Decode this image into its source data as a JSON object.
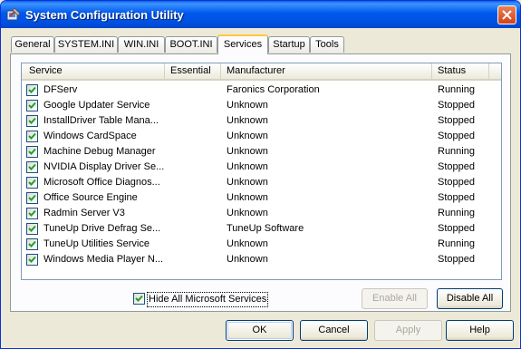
{
  "window": {
    "title": "System Configuration Utility"
  },
  "tabs": [
    {
      "label": "General"
    },
    {
      "label": "SYSTEM.INI"
    },
    {
      "label": "WIN.INI"
    },
    {
      "label": "BOOT.INI"
    },
    {
      "label": "Services",
      "active": true
    },
    {
      "label": "Startup"
    },
    {
      "label": "Tools"
    }
  ],
  "services": {
    "columns": {
      "service": "Service",
      "essential": "Essential",
      "manufacturer": "Manufacturer",
      "status": "Status"
    },
    "rows": [
      {
        "checked": true,
        "service": "DFServ",
        "essential": "",
        "manufacturer": "Faronics Corporation",
        "status": "Running"
      },
      {
        "checked": true,
        "service": "Google Updater Service",
        "essential": "",
        "manufacturer": "Unknown",
        "status": "Stopped"
      },
      {
        "checked": true,
        "service": "InstallDriver Table Mana...",
        "essential": "",
        "manufacturer": "Unknown",
        "status": "Stopped"
      },
      {
        "checked": true,
        "service": "Windows CardSpace",
        "essential": "",
        "manufacturer": "Unknown",
        "status": "Stopped"
      },
      {
        "checked": true,
        "service": "Machine Debug Manager",
        "essential": "",
        "manufacturer": "Unknown",
        "status": "Running"
      },
      {
        "checked": true,
        "service": "NVIDIA Display Driver Se...",
        "essential": "",
        "manufacturer": "Unknown",
        "status": "Stopped"
      },
      {
        "checked": true,
        "service": "Microsoft Office Diagnos...",
        "essential": "",
        "manufacturer": "Unknown",
        "status": "Stopped"
      },
      {
        "checked": true,
        "service": "Office Source Engine",
        "essential": "",
        "manufacturer": "Unknown",
        "status": "Stopped"
      },
      {
        "checked": true,
        "service": "Radmin Server V3",
        "essential": "",
        "manufacturer": "Unknown",
        "status": "Running"
      },
      {
        "checked": true,
        "service": "TuneUp Drive Defrag Se...",
        "essential": "",
        "manufacturer": "TuneUp Software",
        "status": "Stopped"
      },
      {
        "checked": true,
        "service": "TuneUp Utilities Service",
        "essential": "",
        "manufacturer": "Unknown",
        "status": "Running"
      },
      {
        "checked": true,
        "service": "Windows Media Player N...",
        "essential": "",
        "manufacturer": "Unknown",
        "status": "Stopped"
      }
    ]
  },
  "hide_ms": {
    "label": "Hide All Microsoft Services",
    "checked": true
  },
  "panel_buttons": {
    "enable_all": "Enable All",
    "disable_all": "Disable All"
  },
  "dialog_buttons": {
    "ok": "OK",
    "cancel": "Cancel",
    "apply": "Apply",
    "help": "Help"
  },
  "colors": {
    "title_bar": "#0054e3",
    "active_tab_accent": "#ffc83c",
    "close_button": "#d1431a",
    "checkmark": "#21a121"
  }
}
